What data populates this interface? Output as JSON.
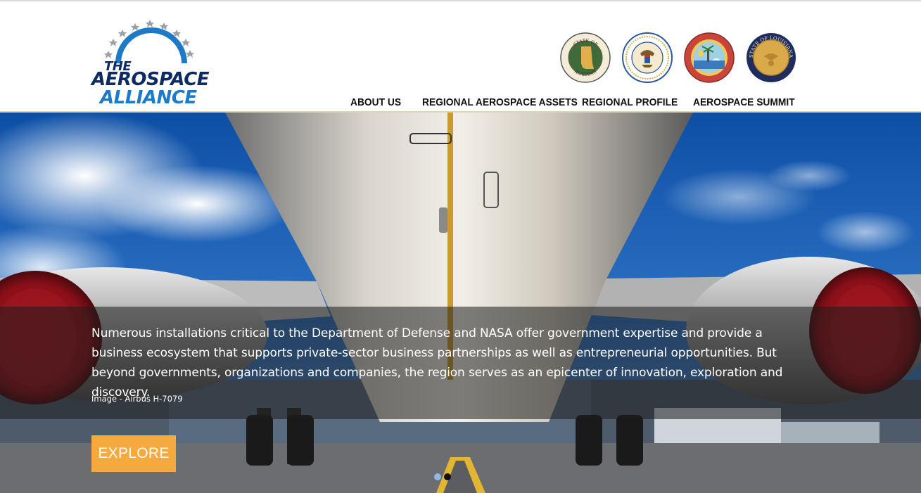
{
  "logo": {
    "line1": "THE",
    "line2": "AEROSPACE",
    "line3": "ALLIANCE"
  },
  "seals": [
    {
      "name": "alabama-seal",
      "text": "STATE OF ALABAMA",
      "bg": "#b8a36a"
    },
    {
      "name": "mississippi-seal",
      "text": "",
      "bg": "#2a5a9e"
    },
    {
      "name": "florida-seal",
      "text": "GREAT SEAL OF THE STATE OF FLORIDA · IN GOD WE TRUST",
      "bg": "#c0392b"
    },
    {
      "name": "louisiana-seal",
      "text": "STATE OF LOUISIANA",
      "bg": "#1f2d5e"
    }
  ],
  "nav": {
    "items": [
      {
        "label": "ABOUT US"
      },
      {
        "label": "REGIONAL AEROSPACE ASSETS"
      },
      {
        "label": "REGIONAL PROFILE"
      },
      {
        "label": "AEROSPACE SUMMIT"
      }
    ]
  },
  "hero": {
    "caption": "Numerous installations critical to the Department of Defense and NASA offer government expertise and provide a business ecosystem that supports private-sector business partnerships as well as entrepreneurial opportunities. But beyond governments, organizations and companies, the region serves as an epicenter of innovation, exploration and discovery.",
    "credit": "Image - Airbus H-7079",
    "cta_label": "EXPLORE"
  },
  "slider": {
    "active_index": 0,
    "count": 2
  },
  "colors": {
    "accent": "#f6a93f",
    "logo_navy": "#0c2b63",
    "logo_blue": "#1d7ac8",
    "header_rule": "#e7d6a6"
  }
}
